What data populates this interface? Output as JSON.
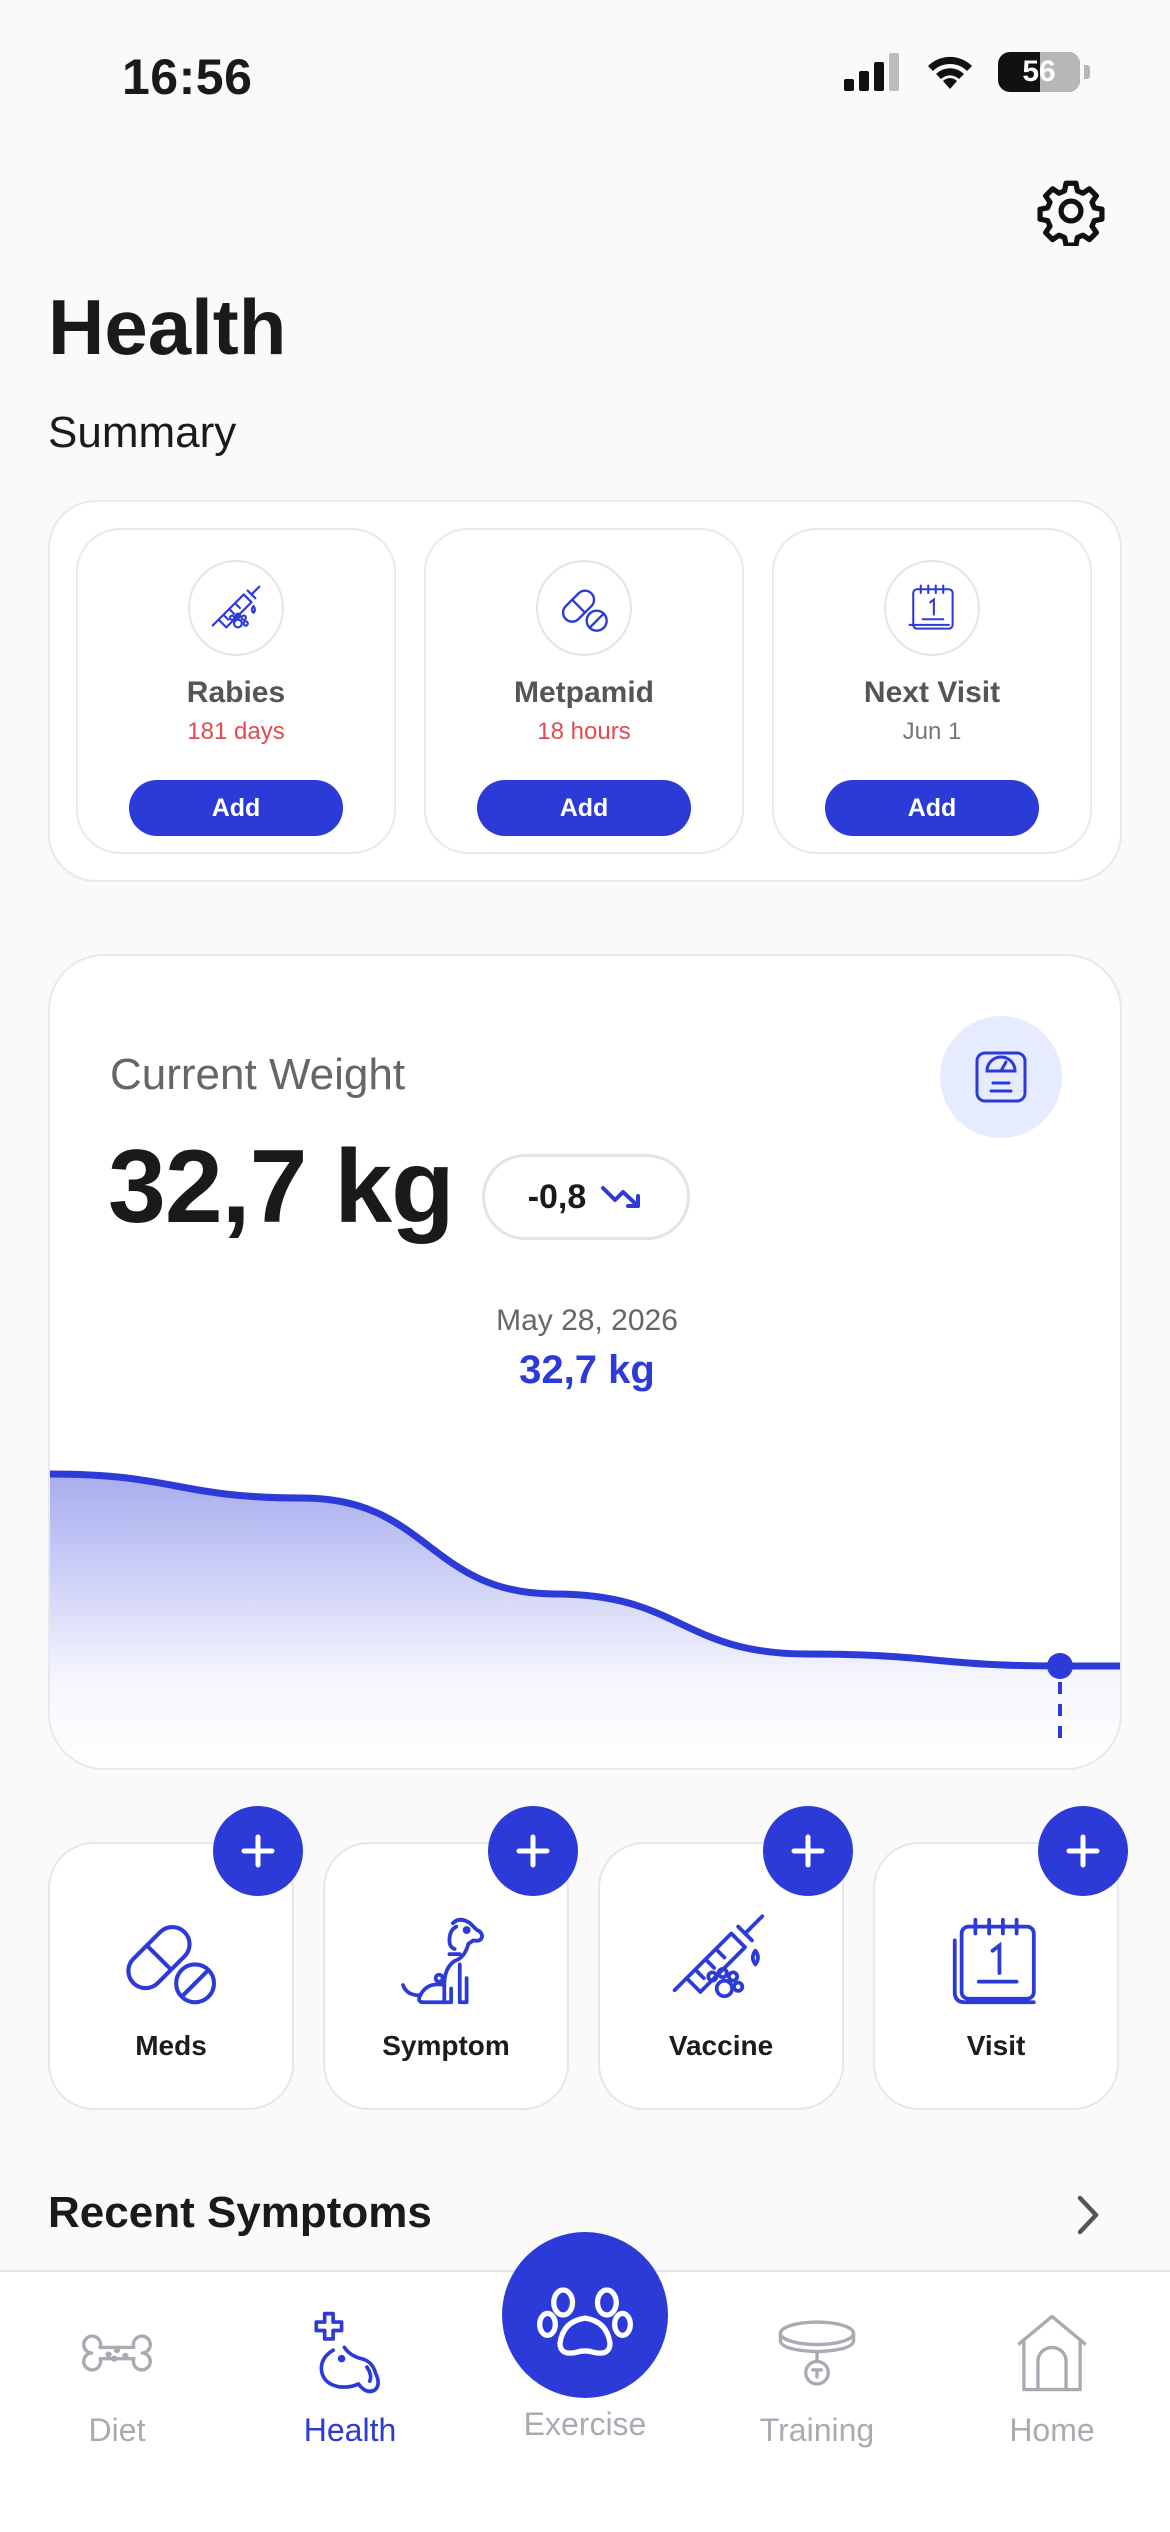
{
  "status": {
    "time": "16:56",
    "battery": "56"
  },
  "header": {
    "title": "Health",
    "summary_title": "Summary"
  },
  "summary": [
    {
      "icon": "vaccine-icon",
      "label": "Rabies",
      "sub": "181 days",
      "button": "Add"
    },
    {
      "icon": "pill-icon",
      "label": "Metpamid",
      "sub": "18 hours",
      "button": "Add"
    },
    {
      "icon": "calendar-icon",
      "label": "Next Visit",
      "sub": "Jun 1",
      "button": "Add"
    }
  ],
  "weight": {
    "label": "Current Weight",
    "value": "32,7 kg",
    "delta": "-0,8",
    "selected_date": "May 28, 2026",
    "selected_value": "32,7 kg"
  },
  "chart_data": {
    "type": "area",
    "x": [
      0,
      1,
      2,
      3,
      4
    ],
    "values": [
      33.5,
      33.4,
      33.0,
      32.75,
      32.7
    ],
    "series": [
      {
        "values": [
          33.5,
          33.4,
          33.0,
          32.75,
          32.7
        ]
      }
    ],
    "ylim": [
      32.2,
      33.7
    ],
    "grid": false,
    "selected_index": 4,
    "color": "#2c3ad8"
  },
  "tiles": [
    {
      "label": "Meds",
      "icon": "pill-icon"
    },
    {
      "label": "Symptom",
      "icon": "dog-icon"
    },
    {
      "label": "Vaccine",
      "icon": "vaccine-icon"
    },
    {
      "label": "Visit",
      "icon": "calendar-icon"
    }
  ],
  "recent": {
    "title": "Recent Symptoms"
  },
  "tabs": [
    {
      "label": "Diet",
      "icon": "bone-icon",
      "active": false
    },
    {
      "label": "Health",
      "icon": "dog-health-icon",
      "active": true
    },
    {
      "label": "Exercise",
      "icon": "paw-icon",
      "active": false
    },
    {
      "label": "Training",
      "icon": "collar-icon",
      "active": false
    },
    {
      "label": "Home",
      "icon": "house-icon",
      "active": false
    }
  ],
  "colors": {
    "accent": "#2c3ad8",
    "alert": "#e5484d",
    "accent_light": "#e7ebff"
  }
}
